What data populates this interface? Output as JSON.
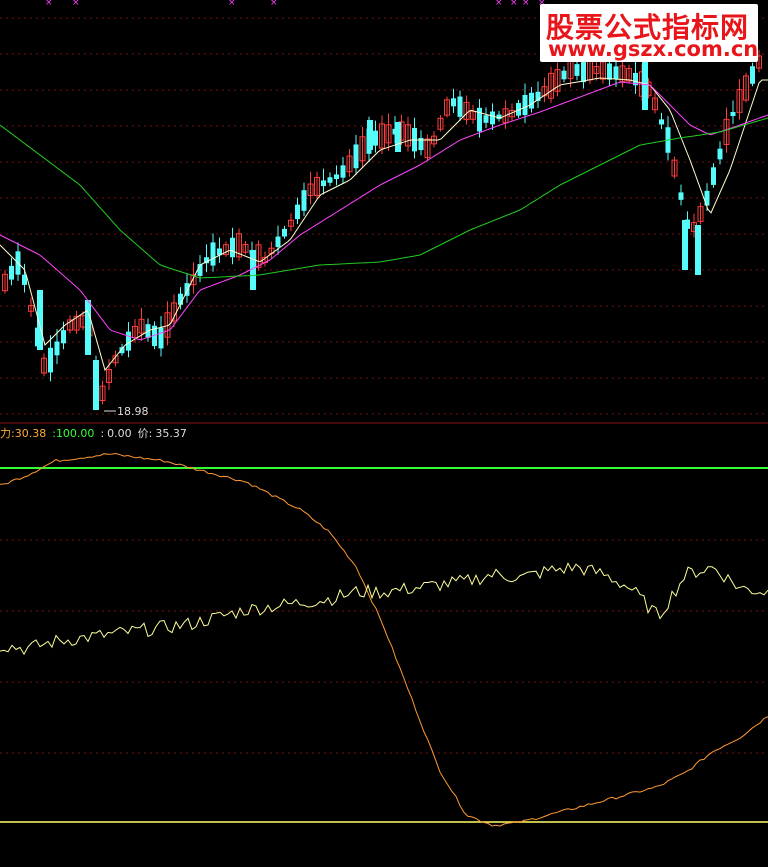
{
  "watermark": {
    "title": "股票公式指标网",
    "url": "www.gszx.com.cn"
  },
  "colors": {
    "background": "#000000",
    "grid": "#7a1010",
    "candle_up": "#ff3c3c",
    "candle_down": "#54fcfc",
    "ma_short": "#ffffcc",
    "ma_mid": "#ff44ff",
    "ma_long": "#22cc22",
    "osc_orange": "#ff9933",
    "osc_yellow": "#ffff99",
    "line_100": "#33ff33",
    "line_0": "#ffff66",
    "legend_label": "#ffaa33"
  },
  "legend": {
    "label1": "力",
    "sep1": ":",
    "value1": "30.38",
    "label2": ":",
    "value2": "100.00",
    "label3": ":",
    "value3": "0.00",
    "label4": "价",
    "sep4": ":",
    "value4": "35.37"
  },
  "chart_data": [
    {
      "type": "candlestick",
      "annotations": [
        {
          "text": "18.98"
        }
      ],
      "series_names": [],
      "grid": true
    },
    {
      "type": "line",
      "reference_lines": [
        100,
        0
      ],
      "ylim": [
        -5,
        110
      ],
      "series": [
        {
          "values": [
            95,
            98,
            102,
            103,
            104,
            103,
            102,
            100,
            98,
            96,
            92,
            88,
            82,
            72,
            55,
            35,
            15,
            2,
            -1,
            0,
            2,
            4,
            6,
            8,
            10,
            14,
            20,
            24,
            30
          ]
        },
        {
          "values": [
            50,
            49,
            51,
            52,
            53,
            54,
            55,
            56,
            58,
            60,
            61,
            62,
            63,
            65,
            65,
            66,
            67,
            68,
            70,
            69,
            71,
            72,
            70,
            66,
            58,
            70,
            72,
            66,
            65
          ]
        }
      ]
    }
  ]
}
